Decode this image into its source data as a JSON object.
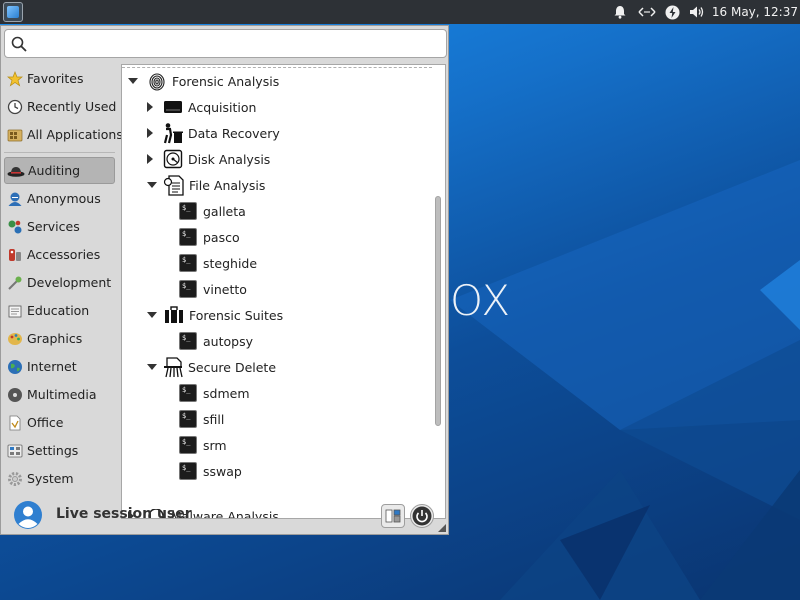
{
  "panel": {
    "clock": "16 May, 12:37",
    "tray_icons": [
      "bell-icon",
      "network-arrows-icon",
      "power-bolt-icon",
      "volume-icon"
    ]
  },
  "wallpaper": {
    "text": "OX"
  },
  "search": {
    "value": "",
    "placeholder": ""
  },
  "categories": [
    {
      "label": "Favorites",
      "icon": "star-icon"
    },
    {
      "label": "Recently Used",
      "icon": "clock-icon"
    },
    {
      "label": "All Applications",
      "icon": "folder-grid-icon"
    },
    {
      "label": "Auditing",
      "icon": "fedora-hat-icon",
      "active": true
    },
    {
      "label": "Anonymous",
      "icon": "anonymous-icon"
    },
    {
      "label": "Services",
      "icon": "services-icon"
    },
    {
      "label": "Accessories",
      "icon": "accessories-icon"
    },
    {
      "label": "Development",
      "icon": "development-icon"
    },
    {
      "label": "Education",
      "icon": "education-icon"
    },
    {
      "label": "Graphics",
      "icon": "graphics-icon"
    },
    {
      "label": "Internet",
      "icon": "globe-icon"
    },
    {
      "label": "Multimedia",
      "icon": "multimedia-icon"
    },
    {
      "label": "Office",
      "icon": "office-icon"
    },
    {
      "label": "Settings",
      "icon": "settings-icon"
    },
    {
      "label": "System",
      "icon": "system-gear-icon"
    }
  ],
  "tree": {
    "forensic_analysis": "Forensic Analysis",
    "acquisition": "Acquisition",
    "data_recovery": "Data Recovery",
    "disk_analysis": "Disk Analysis",
    "file_analysis": "File Analysis",
    "file_analysis_items": [
      "galleta",
      "pasco",
      "steghide",
      "vinetto"
    ],
    "forensic_suites": "Forensic Suites",
    "forensic_suites_items": [
      "autopsy"
    ],
    "secure_delete": "Secure Delete",
    "secure_delete_items": [
      "sdmem",
      "sfill",
      "srm",
      "sswap"
    ],
    "malware_analysis": "Malware Analysis"
  },
  "footer": {
    "user": "Live session user"
  }
}
